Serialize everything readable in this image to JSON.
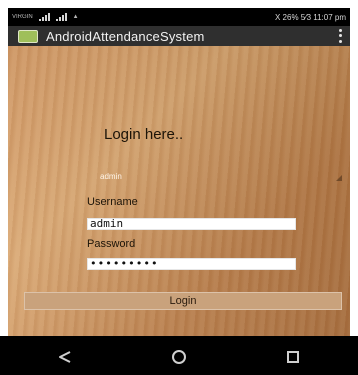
{
  "status_bar": {
    "left_tiny_text": "VIRGIN",
    "right_text": "X 26% 5⁄3 11:07 pm"
  },
  "app_bar": {
    "title": "AndroidAttendanceSystem"
  },
  "login": {
    "heading": "Login here..",
    "role_spinner_value": "admin",
    "username_label": "Username",
    "username_value": "admin",
    "password_label": "Password",
    "password_value": "•••••••••",
    "button_label": "Login"
  },
  "icons": {
    "app_icon": "android-app-icon",
    "overflow_menu": "overflow-menu-icon",
    "nav_back": "back-icon",
    "nav_home": "home-icon",
    "nav_recent": "recent-apps-icon"
  },
  "colors": {
    "app_bar_bg": "#2f2f2f",
    "wood_base": "#c98b52",
    "button_bg": "#c9a27c"
  }
}
